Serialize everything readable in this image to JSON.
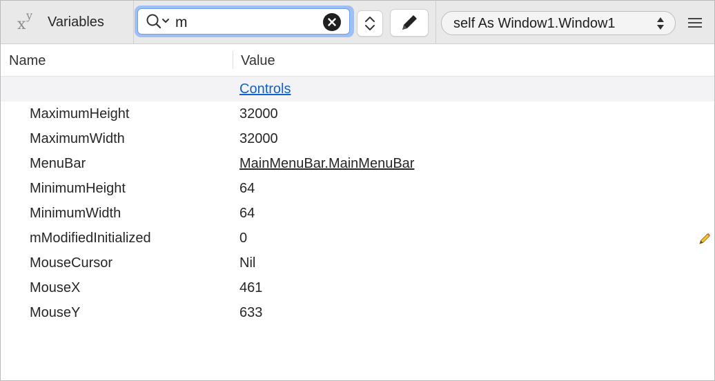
{
  "toolbar": {
    "vars_icon_text": "x y",
    "vars_label": "Variables",
    "search_value": "m",
    "context_label": "self As Window1.Window1"
  },
  "header": {
    "name_col": "Name",
    "value_col": "Value"
  },
  "group": {
    "link_label": "Controls"
  },
  "rows": [
    {
      "name": "MaximumHeight",
      "value": "32000",
      "link": false
    },
    {
      "name": "MaximumWidth",
      "value": "32000",
      "link": false
    },
    {
      "name": "MenuBar",
      "value": "MainMenuBar.MainMenuBar",
      "link": true
    },
    {
      "name": "MinimumHeight",
      "value": "64",
      "link": false
    },
    {
      "name": "MinimumWidth",
      "value": "64",
      "link": false
    },
    {
      "name": "mModifiedInitialized",
      "value": "0",
      "link": false,
      "editable": true
    },
    {
      "name": "MouseCursor",
      "value": "Nil",
      "link": false
    },
    {
      "name": "MouseX",
      "value": "461",
      "link": false
    },
    {
      "name": "MouseY",
      "value": "633",
      "link": false
    }
  ],
  "icons": {
    "vars": "xy-icon",
    "search": "search-icon",
    "clear": "clear-icon",
    "stepper": "stepper-icon",
    "pencil": "pencil-icon",
    "context_arrows": "updown-icon",
    "menu": "menu-icon",
    "edit": "edit-pencil-icon"
  },
  "colors": {
    "link": "#1060d0",
    "focus_ring": "#9fc0f5",
    "toolbar_bg": "#e9e9ea"
  }
}
